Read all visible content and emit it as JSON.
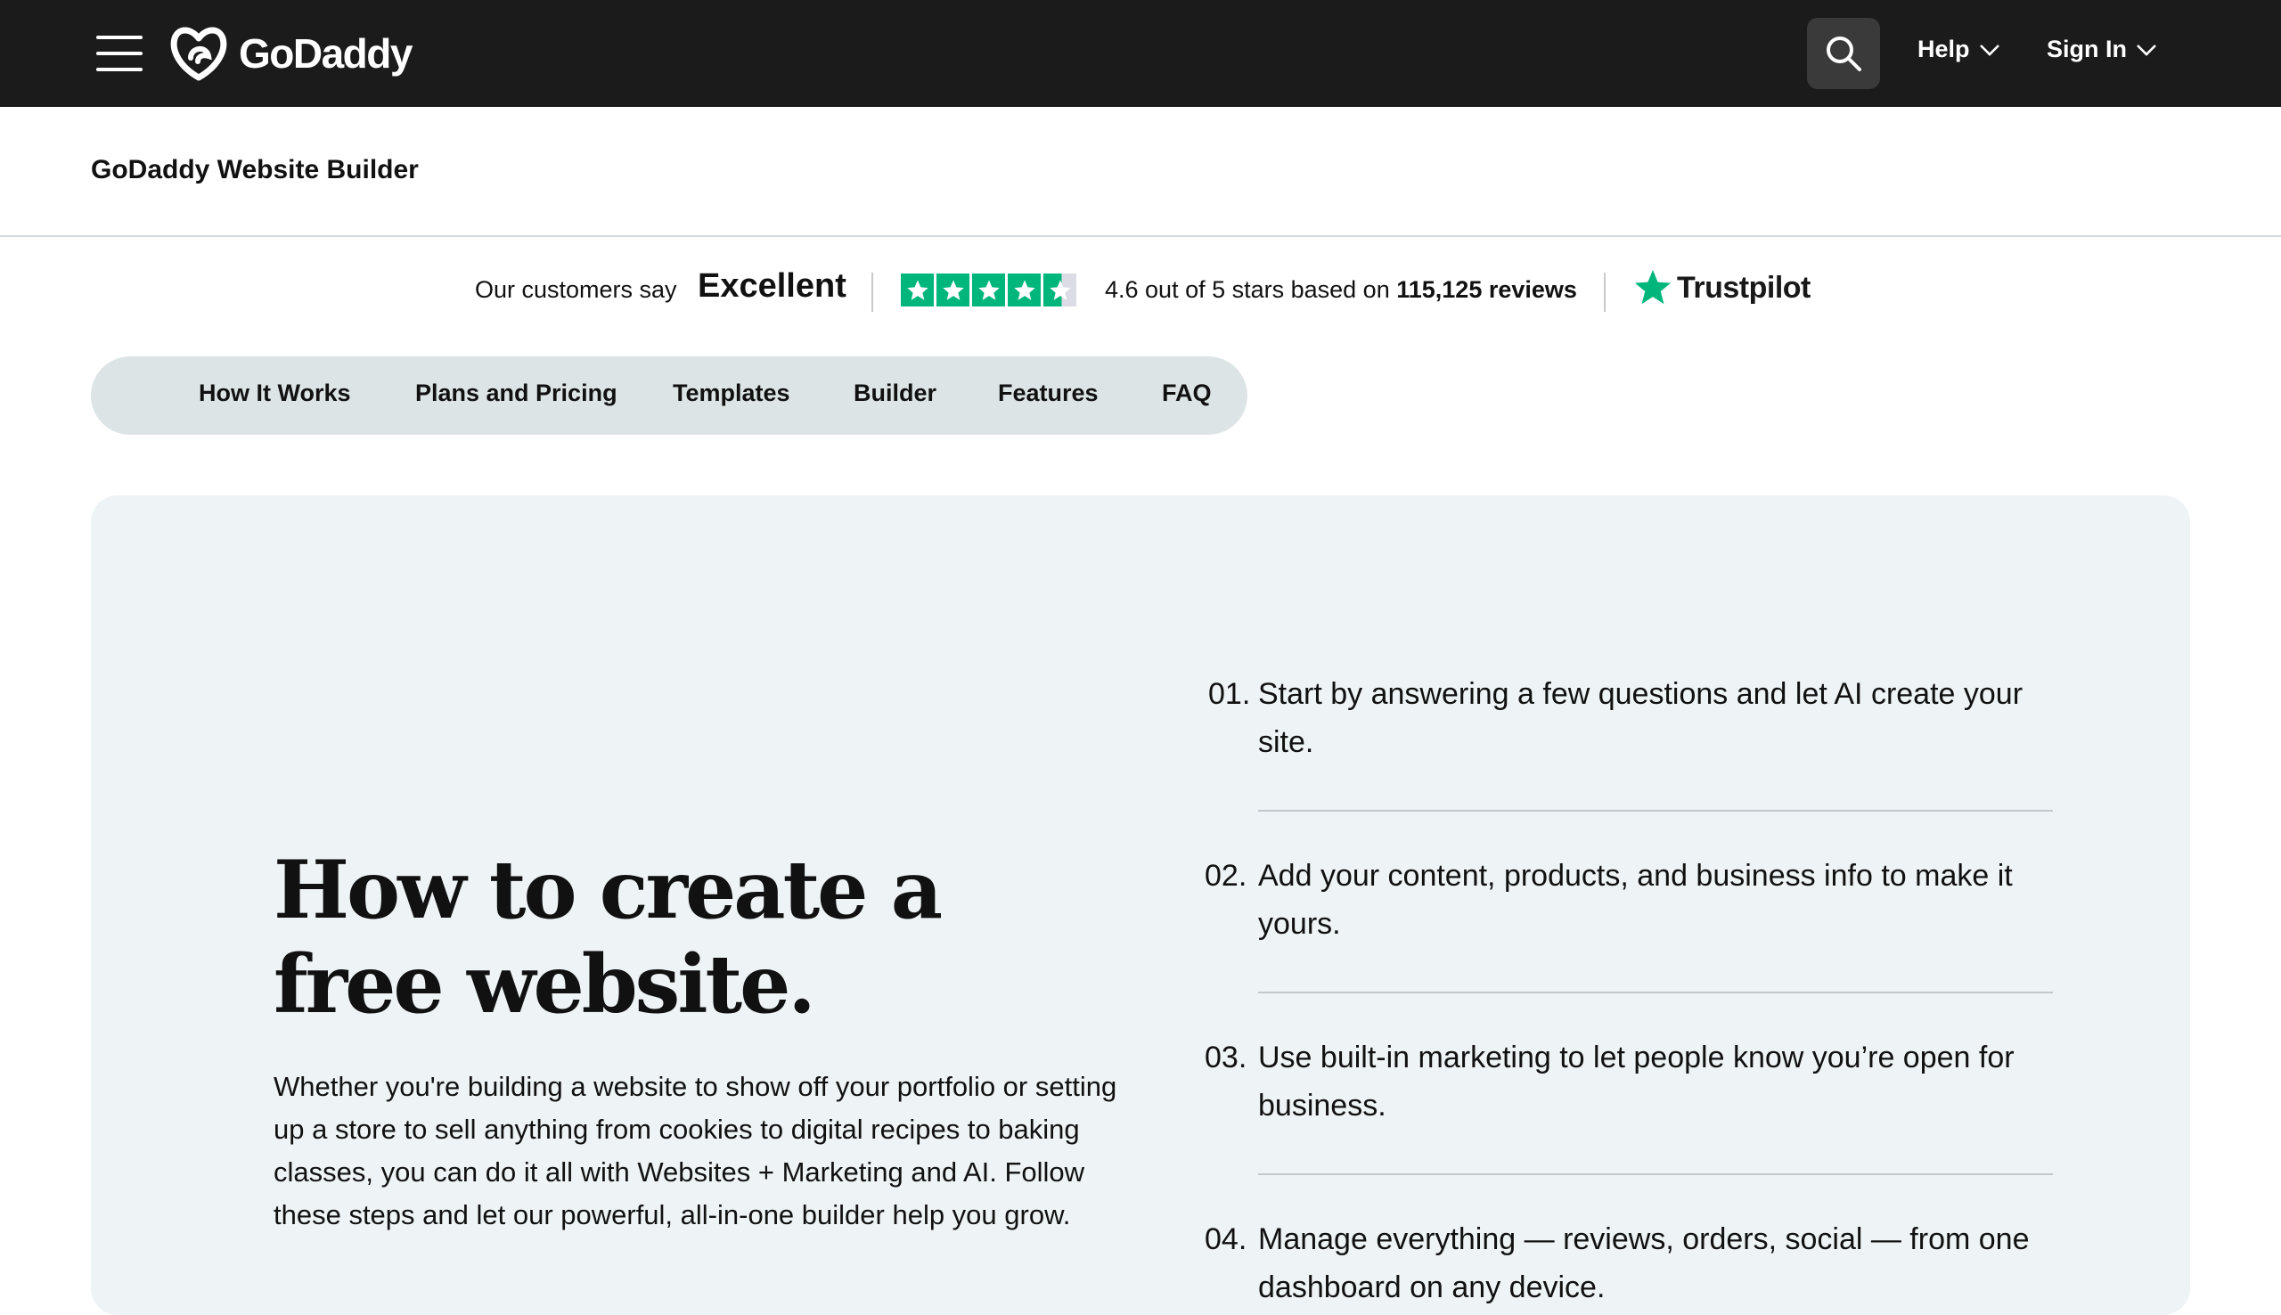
{
  "header": {
    "menu_icon": "hamburger-menu-icon",
    "logo_text": "GoDaddy",
    "search_icon": "search-icon",
    "help_label": "Help",
    "signin_label": "Sign In"
  },
  "product": {
    "title": "GoDaddy Website Builder"
  },
  "trustpilot": {
    "customers_say": "Our customers say",
    "rating_word": "Excellent",
    "stars": 4.6,
    "rating_text": "4.6 out of 5 stars based on",
    "review_count": "115,125",
    "reviews_word": "reviews",
    "brand": "Trustpilot",
    "star_color": "#00b67a"
  },
  "tabs": [
    {
      "label": "How It Works"
    },
    {
      "label": "Plans and Pricing"
    },
    {
      "label": "Templates"
    },
    {
      "label": "Builder"
    },
    {
      "label": "Features"
    },
    {
      "label": "FAQ"
    }
  ],
  "hero": {
    "heading": "How to create a free website.",
    "body": "Whether you're building a website to show off your portfolio or setting up a store to sell anything from cookies to digital recipes to baking classes, you can do it all with Websites + Marketing and AI. Follow these steps and let our powerful, all-in-one builder help you grow."
  },
  "steps": [
    {
      "num": "01.",
      "text": "Start by answering a few questions and let AI create your site."
    },
    {
      "num": "02.",
      "text": "Add your content, products, and business info to make it yours."
    },
    {
      "num": "03.",
      "text": "Use built-in marketing to let people know you’re open for business."
    },
    {
      "num": "04.",
      "text": "Manage everything — reviews, orders, social — from one dashboard on any device."
    }
  ],
  "colors": {
    "topbar": "#1b1b1b",
    "tabs_bg": "#dde4e6",
    "card_bg": "#eef3f5",
    "trustpilot_green": "#00b67a"
  }
}
